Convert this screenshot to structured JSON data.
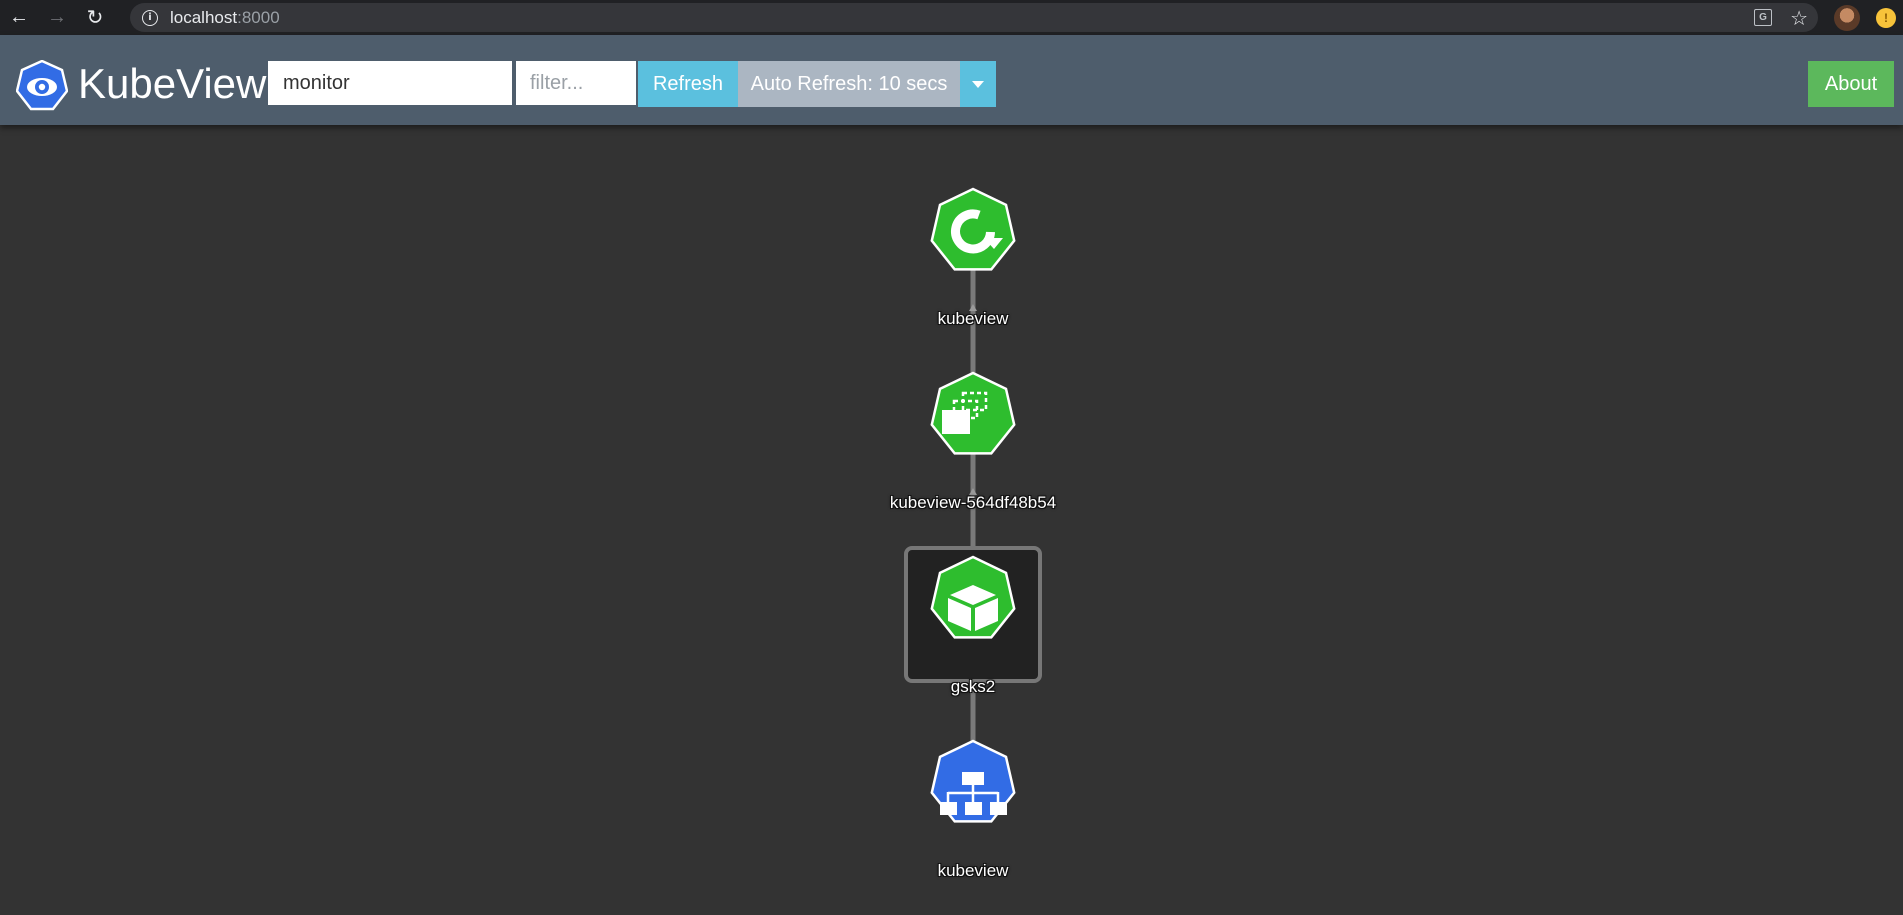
{
  "browser": {
    "url_host": "localhost",
    "url_port": ":8000",
    "icons": [
      "back-icon",
      "forward-icon",
      "reload-icon",
      "info-icon",
      "translate-icon",
      "star-icon"
    ]
  },
  "app": {
    "title": "KubeView",
    "namespace_value": "monitor",
    "filter_placeholder": "filter...",
    "refresh_label": "Refresh",
    "auto_refresh_label": "Auto Refresh: 10 secs",
    "about_label": "About"
  },
  "colors": {
    "navbar": "#4e5d6c",
    "info_button": "#5bc0de",
    "success_button": "#5cb85c",
    "node_green": "#2ebd2e",
    "node_blue": "#326ce5",
    "canvas": "#333333"
  },
  "graph": {
    "nodes": [
      {
        "label": "kubeview",
        "kind": "deployment",
        "icon": "deployment-icon"
      },
      {
        "label": "kubeview-564df48b54",
        "kind": "replicaset",
        "icon": "replicaset-icon"
      },
      {
        "label": "gsks2",
        "kind": "pod",
        "icon": "pod-icon"
      },
      {
        "label": "kubeview",
        "kind": "service",
        "icon": "service-icon"
      }
    ]
  }
}
